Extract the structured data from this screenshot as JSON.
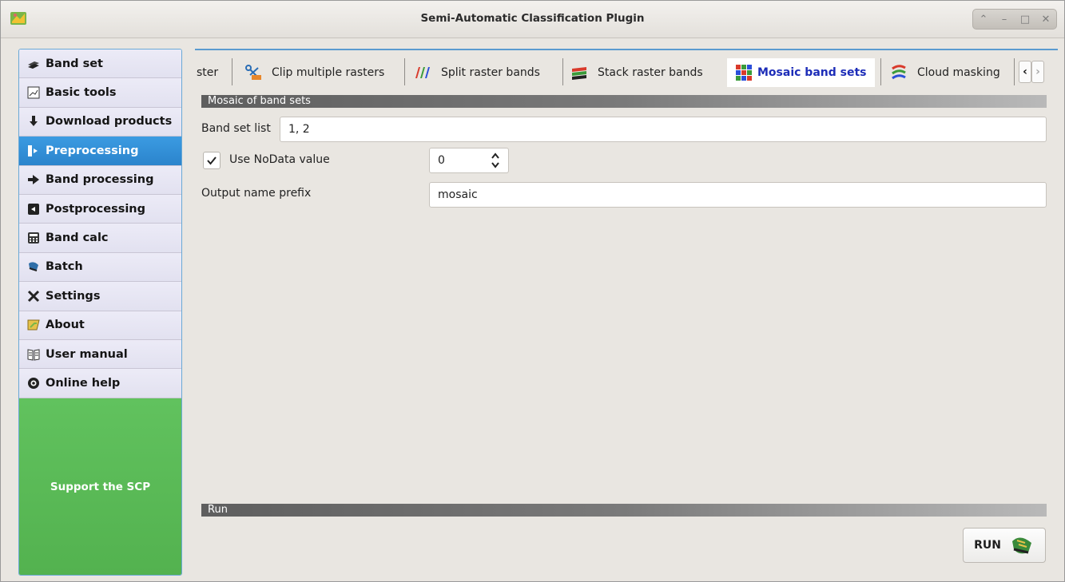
{
  "window": {
    "title": "Semi-Automatic Classification Plugin",
    "controls": [
      "up-icon",
      "minimize-icon",
      "maximize-icon",
      "close-icon"
    ]
  },
  "sidebar": {
    "items": [
      {
        "label": "Band set",
        "icon": "band-set-icon"
      },
      {
        "label": "Basic tools",
        "icon": "basic-tools-icon"
      },
      {
        "label": "Download products",
        "icon": "download-icon"
      },
      {
        "label": "Preprocessing",
        "icon": "preprocessing-icon",
        "active": true
      },
      {
        "label": "Band processing",
        "icon": "band-processing-icon"
      },
      {
        "label": "Postprocessing",
        "icon": "postprocessing-icon"
      },
      {
        "label": "Band calc",
        "icon": "band-calc-icon"
      },
      {
        "label": "Batch",
        "icon": "batch-icon"
      },
      {
        "label": "Settings",
        "icon": "settings-icon"
      },
      {
        "label": "About",
        "icon": "about-icon"
      },
      {
        "label": "User manual",
        "icon": "user-manual-icon"
      },
      {
        "label": "Online help",
        "icon": "online-help-icon"
      }
    ],
    "support_label": "Support the SCP"
  },
  "tabs": {
    "items": [
      {
        "label": "ster"
      },
      {
        "label": "Clip multiple rasters",
        "icon": "clip-icon"
      },
      {
        "label": "Split raster bands",
        "icon": "split-icon"
      },
      {
        "label": "Stack raster bands",
        "icon": "stack-icon"
      },
      {
        "label": "Mosaic band sets",
        "icon": "mosaic-icon",
        "active": true
      },
      {
        "label": "Cloud masking",
        "icon": "cloud-mask-icon"
      }
    ]
  },
  "form": {
    "section_title": "Mosaic of band sets",
    "band_set_list_label": "Band set list",
    "band_set_list_value": "1, 2",
    "nodata_label": "Use NoData value",
    "nodata_checked": true,
    "nodata_value": "0",
    "output_prefix_label": "Output name prefix",
    "output_prefix_value": "mosaic"
  },
  "run": {
    "section_title": "Run",
    "button_label": "RUN"
  },
  "colors": {
    "active_nav": "#2b84cc",
    "active_tab_text": "#1d2db8",
    "support_green": "#5bbb57"
  }
}
